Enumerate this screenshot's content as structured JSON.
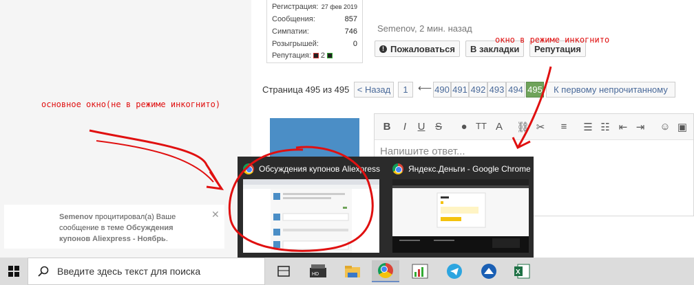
{
  "user_info": {
    "registration_label": "Регистрация:",
    "registration_value": "27 фев 2019",
    "messages_label": "Сообщения:",
    "messages_value": "857",
    "likes_label": "Симпатии:",
    "likes_value": "746",
    "raffles_label": "Розыгрышей:",
    "raffles_value": "0",
    "reputation_label": "Репутация:",
    "reputation_value": "2"
  },
  "post_meta": "Semenov, 2 мин. назад",
  "post_actions": {
    "report": "Пожаловаться",
    "bookmark": "В закладки",
    "reputation": "Репутация"
  },
  "pagination": {
    "label": "Страница 495 из 495",
    "back": "< Назад",
    "first": "1",
    "arrow": "⟵",
    "pages": [
      "490",
      "491",
      "492",
      "493",
      "494",
      "495"
    ],
    "current": "495",
    "first_unread": "К первому непрочитанному"
  },
  "editor": {
    "placeholder": "Напишите ответ..."
  },
  "notification": {
    "user": "Semenov",
    "text_before": " процитировал(а) Ваше сообщение в теме ",
    "topic": "Обсуждения купонов Aliexpress - Ноябрь",
    "text_after": ".",
    "close": "✕"
  },
  "task_preview": {
    "window1_title": "Обсуждения купонов Aliexpress",
    "window2_title": "Яндекс.Деньги - Google Chrome"
  },
  "annotations": {
    "main_window": "основное окно(не в режиме инкогнито)",
    "incognito_window": "окно в режиме инкогнито"
  },
  "taskbar": {
    "search_placeholder": "Введите здесь текст для поиска",
    "apps": [
      "task-view",
      "media-player",
      "file-explorer",
      "chrome",
      "charts-app",
      "telegram",
      "vpn-app",
      "excel"
    ]
  },
  "colors": {
    "annotation": "#e01010",
    "current_page": "#6fa35a",
    "avatar": "#4b8ec6"
  }
}
